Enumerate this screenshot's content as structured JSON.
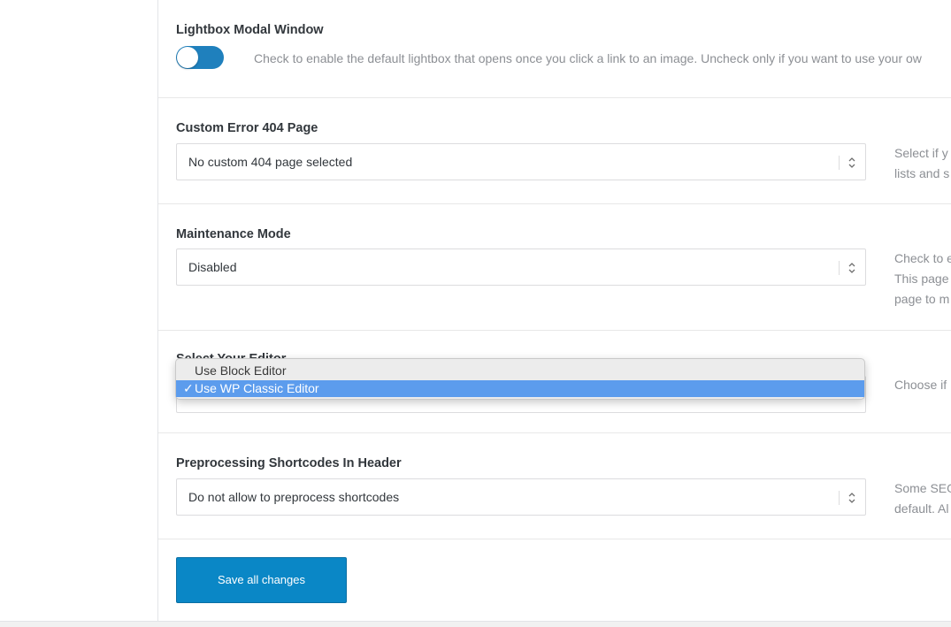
{
  "lightbox": {
    "title": "Lightbox Modal Window",
    "toggle_on": true,
    "description": "Check to enable the default lightbox that opens once you click a link to an image. Uncheck only if you want to use your ow"
  },
  "error404": {
    "title": "Custom Error 404 Page",
    "value": "No custom 404 page selected",
    "description_lines": [
      "Select if y",
      "lists and s"
    ]
  },
  "maintenance": {
    "title": "Maintenance Mode",
    "value": "Disabled",
    "description_lines": [
      "Check to e",
      "This page",
      "page to m"
    ]
  },
  "editor": {
    "title": "Select Your Editor",
    "description": "Choose if",
    "options": [
      "Use Block Editor",
      "Use WP Classic Editor"
    ],
    "selected_mark": "✓"
  },
  "shortcodes": {
    "title": "Preprocessing Shortcodes In Header",
    "value": "Do not allow to preprocess shortcodes",
    "description_lines": [
      "Some SEO",
      "default. Al"
    ]
  },
  "save_label": "Save all changes",
  "colors": {
    "accent": "#0a87c6",
    "toggle": "#1f80bd",
    "selection": "#5c9ced"
  }
}
